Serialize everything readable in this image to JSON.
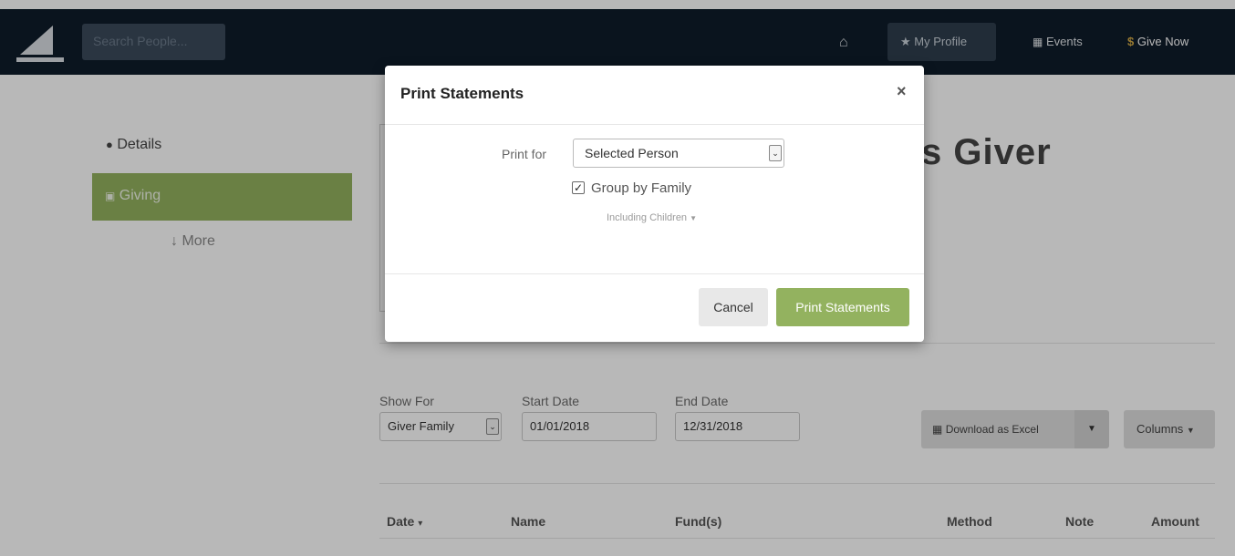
{
  "nav": {
    "search_placeholder": "Search People...",
    "home_icon": "⌂",
    "profile_label": "My Profile",
    "events_label": "Events",
    "give_currency": "$",
    "give_label": "Give Now"
  },
  "sidebar": {
    "details_label": "Details",
    "giving_label": "Giving",
    "more_label": "More"
  },
  "person": {
    "name_partial": "s Giver"
  },
  "filters": {
    "show_for_label": "Show For",
    "show_for_value": "Giver Family",
    "start_label": "Start Date",
    "start_value": "01/01/2018",
    "end_label": "End Date",
    "end_value": "12/31/2018"
  },
  "actions": {
    "excel_label": "Download as Excel",
    "columns_label": "Columns"
  },
  "table": {
    "headers": [
      "Date",
      "Name",
      "Fund(s)",
      "Method",
      "Note",
      "Amount"
    ]
  },
  "modal": {
    "title": "Print Statements",
    "close": "×",
    "print_for_label": "Print for",
    "print_for_value": "Selected Person",
    "group_label": "Group by Family",
    "group_checked": true,
    "including_label": "Including Children",
    "cancel_label": "Cancel",
    "print_label": "Print Statements"
  },
  "colors": {
    "nav_bg": "#0f1c2a",
    "accent_green": "#93b25f",
    "give_gold": "#d4aa45"
  }
}
